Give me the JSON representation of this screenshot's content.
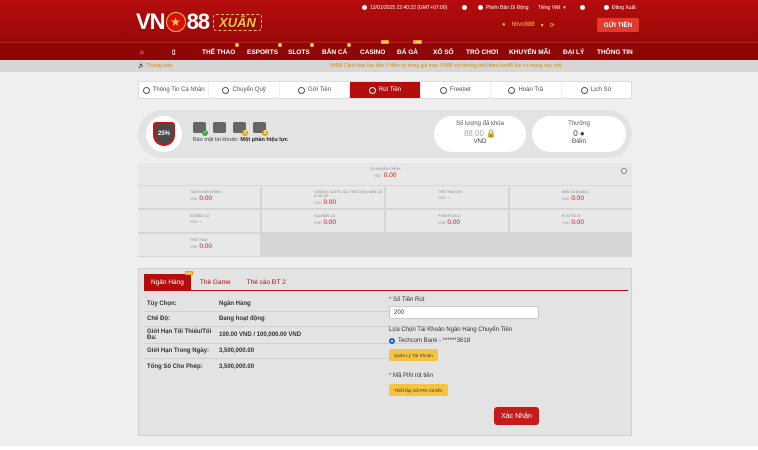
{
  "header": {
    "logo_text_a": "VN",
    "logo_text_b": "88",
    "logo_badge": "XUÂN",
    "datetime": "13/01/2025 22:40:22 (GMT+07:00)",
    "version": "Phiên Bản Di Động",
    "language": "Tiếng Việt",
    "logout": "Đăng Xuất",
    "username": "hhvn888",
    "deposit_button": "GỬI TIỀN",
    "brand_color": "#b50d0d",
    "accent_color": "#f5c542"
  },
  "nav": {
    "items": [
      {
        "label": "THỂ THAO"
      },
      {
        "label": "ESPORTS"
      },
      {
        "label": "SLOTS"
      },
      {
        "label": "BẮN CÁ"
      },
      {
        "label": "CASINO"
      },
      {
        "label": "ĐÁ GÀ"
      },
      {
        "label": "XỔ SỐ"
      },
      {
        "label": "TRÒ CHƠI"
      },
      {
        "label": "KHUYẾN MÃI"
      },
      {
        "label": "ĐẠI LÝ"
      },
      {
        "label": "THÔNG TIN"
      }
    ],
    "live_badge": "LIVE",
    "home_icon": "home-icon",
    "mobile_icon": "mobile-icon"
  },
  "notice": {
    "label": "Thông báo",
    "text": "VN88 Cảnh báo lừa đảo !! Hiện có trang giả mạo VN88 với đường link  https://vn88.fun  >> mạng này chủ"
  },
  "tabs": [
    {
      "label": "Thông Tin Cá Nhân",
      "icon": "user-icon"
    },
    {
      "label": "Chuyển Quỹ",
      "icon": "transfer-icon"
    },
    {
      "label": "Gửi Tiền",
      "icon": "deposit-icon"
    },
    {
      "label": "Rút Tiền",
      "icon": "withdraw-icon"
    },
    {
      "label": "Freebet",
      "icon": "freebet-icon"
    },
    {
      "label": "Hoàn Trả",
      "icon": "rebate-icon"
    },
    {
      "label": "Lịch Sử",
      "icon": "history-icon"
    }
  ],
  "profile": {
    "security_percent": "25%",
    "security_label": "Bảo mật tài khoản:",
    "security_value": "Một phần hiệu lực",
    "locked_label": "Số lượng đã khóa",
    "locked_value": "88.00",
    "locked_unit": "VND",
    "points_label": "Thưởng",
    "points_value": "0",
    "points_unit": "Điểm"
  },
  "wallet": {
    "main_name": "TÀI KHOẢN CHÍNH",
    "unit": "VND",
    "zero": "0.00",
    "dash": "-",
    "cells": [
      {
        "name": "TÀI KHOẢN CHÍNH",
        "value": "0.00"
      },
      {
        "name": "CASINO, SLOTS, ALL TRÒ CHƠI, BẮN CÁ & XỔ SỐ",
        "value": "0.00"
      },
      {
        "name": "THỂ THAO BTI",
        "value": "-"
      },
      {
        "name": "BẮN CÁ (SABA)",
        "value": "0.00"
      },
      {
        "name": "SỐ BẮN CÁ",
        "value": "-"
      },
      {
        "name": "VUA BẮN CÁ",
        "value": "0.00"
      },
      {
        "name": "POKER (LKG)",
        "value": "0.00"
      },
      {
        "name": "PLAYTECH",
        "value": "0.00"
      },
      {
        "name": "THỂ THAO",
        "value": "0.00"
      }
    ]
  },
  "withdraw": {
    "tabs": [
      {
        "label": "Ngân Hàng"
      },
      {
        "label": "Thẻ Game"
      },
      {
        "label": "Thẻ cào ĐT 2"
      }
    ],
    "new_badge": "MỚI",
    "rows": [
      {
        "k": "Tùy Chọn:",
        "v": "Ngân Hàng"
      },
      {
        "k": "Chế Độ:",
        "v": "Đang hoạt động"
      },
      {
        "k": "Giới Hạn Tối Thiểu/Tối Đa:",
        "v": "100.00 VND / 100,000.00 VND"
      },
      {
        "k": "Giới Hạn Trong Ngày:",
        "v": "3,500,000.00"
      },
      {
        "k": "Tổng Số Cho Phép:",
        "v": "3,500,000.00"
      }
    ],
    "amount_label": "Số Tiền Rút",
    "amount_value": "200",
    "bank_select_label": "Lựa Chọn Tài Khoản Ngân Hàng Chuyển Tiền",
    "bank_option": "Techcom Bank - ******3618",
    "manage_button": "Quản Lý Tài Khoản",
    "pin_label": "Mã PIN rút tiền",
    "pin_button": "Thiết lập mã PIN rút tiền",
    "submit": "Xác Nhận"
  }
}
